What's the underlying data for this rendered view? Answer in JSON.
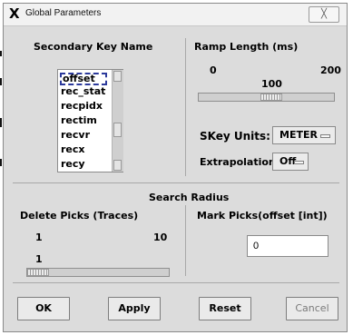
{
  "window": {
    "title": "Global Parameters",
    "app_icon_glyph": "X",
    "close_glyph": "╳"
  },
  "secondary_key": {
    "label": "Secondary Key Name",
    "items": [
      "offset",
      "rec_stat",
      "recpidx",
      "rectim",
      "recvr",
      "recx",
      "recy"
    ],
    "selected": "offset"
  },
  "ramp_length": {
    "label": "Ramp Length (ms)",
    "min": "0",
    "max": "200",
    "value": "100",
    "value_fraction": 0.5
  },
  "skey_units": {
    "label": "SKey Units:",
    "value": "METER"
  },
  "extrapolation": {
    "label": "Extrapolation",
    "value": "Off"
  },
  "search_radius": {
    "label": "Search Radius"
  },
  "delete_picks": {
    "label": "Delete Picks (Traces)",
    "min": "1",
    "max": "10",
    "value": "1",
    "value_fraction": 0.0
  },
  "mark_picks": {
    "label": "Mark Picks(offset [int])",
    "value": "0"
  },
  "buttons": {
    "ok": "OK",
    "apply": "Apply",
    "reset": "Reset",
    "cancel": "Cancel"
  },
  "colors": {
    "panel": "#dcdcdc",
    "selection_border": "#2c3a9c",
    "disabled_text": "#7b7b7b"
  }
}
